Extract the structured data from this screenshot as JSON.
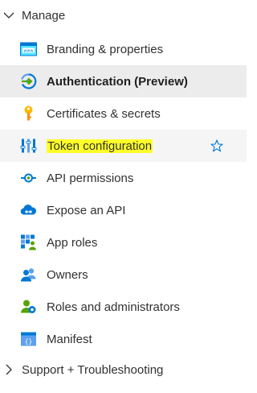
{
  "manage_group": {
    "label": "Manage",
    "expanded": true
  },
  "items": [
    {
      "label": "Branding & properties",
      "icon": "branding-icon",
      "selected": false
    },
    {
      "label": "Authentication (Preview)",
      "icon": "authentication-icon",
      "selected": true
    },
    {
      "label": "Certificates & secrets",
      "icon": "key-icon",
      "selected": false
    },
    {
      "label": "Token configuration",
      "icon": "token-configuration-icon",
      "selected": false,
      "highlighted": true,
      "favorite_icon": "star-icon"
    },
    {
      "label": "API permissions",
      "icon": "api-permissions-icon",
      "selected": false
    },
    {
      "label": "Expose an API",
      "icon": "cloud-icon",
      "selected": false
    },
    {
      "label": "App roles",
      "icon": "app-roles-icon",
      "selected": false
    },
    {
      "label": "Owners",
      "icon": "owners-icon",
      "selected": false
    },
    {
      "label": "Roles and administrators",
      "icon": "roles-admins-icon",
      "selected": false
    },
    {
      "label": "Manifest",
      "icon": "manifest-icon",
      "selected": false
    }
  ],
  "support_group": {
    "label": "Support + Troubleshooting",
    "expanded": false
  },
  "colors": {
    "accent": "#0078d4",
    "selected_bg": "#ececec",
    "highlight": "#ffff2a",
    "key": "#ffb900"
  }
}
